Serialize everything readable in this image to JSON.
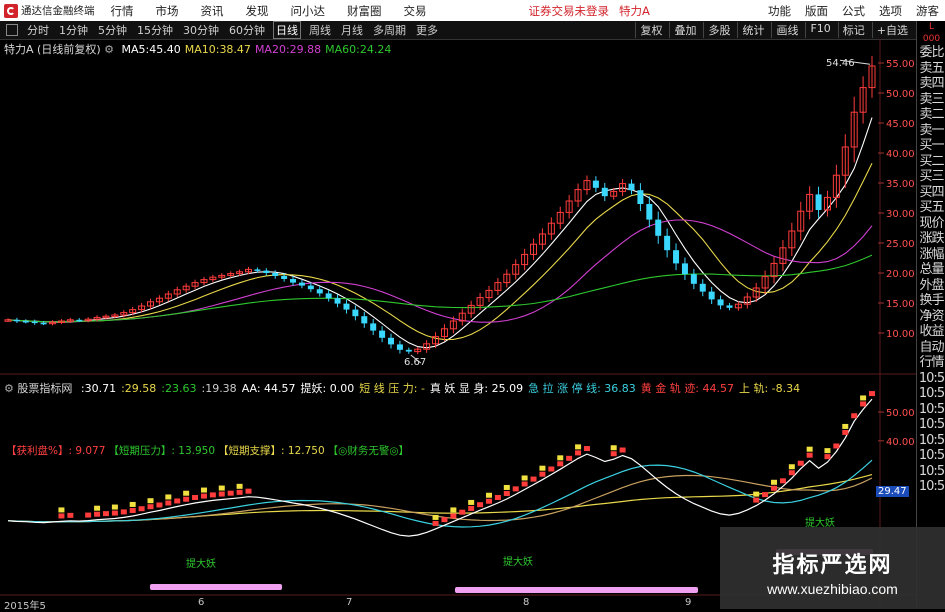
{
  "menubar": {
    "brand": "通达信金融终端",
    "items": [
      "行情",
      "市场",
      "资讯",
      "发现",
      "问小达",
      "财富圈",
      "交易"
    ],
    "status": "证券交易未登录",
    "stock_name": "特力A",
    "right_items": [
      "功能",
      "版面",
      "公式",
      "选项",
      "游客"
    ]
  },
  "periodbar": {
    "periods": [
      "分时",
      "1分钟",
      "5分钟",
      "15分钟",
      "30分钟",
      "60分钟",
      "日线",
      "周线",
      "月线",
      "多周期",
      "更多"
    ],
    "selected": "日线",
    "tools": [
      "复权",
      "叠加",
      "多股",
      "统计",
      "画线",
      "F10",
      "标记",
      "+自选"
    ]
  },
  "rpanel": {
    "header_top": "L",
    "header_sub": "000",
    "items": [
      "委比",
      "卖五",
      "卖四",
      "卖三",
      "卖二",
      "卖一",
      "买一",
      "买二",
      "买三",
      "买四",
      "买五",
      "现价",
      "涨跌",
      "涨幅",
      "总量",
      "外盘",
      "换手",
      "净资",
      "收益",
      "自动",
      "行情",
      "10:5",
      "10:5",
      "10:5",
      "10:5",
      "10:5",
      "10:5",
      "10:5",
      "10:5"
    ]
  },
  "main_legend": {
    "title": "特力A",
    "mode": "(日线前复权)",
    "ma": [
      {
        "label": "MA5:",
        "value": "45.40",
        "color": "#ffffff"
      },
      {
        "label": "MA10:",
        "value": "38.47",
        "color": "#e8d84a"
      },
      {
        "label": "MA20:",
        "value": "29.88",
        "color": "#d040d0"
      },
      {
        "label": "MA60:",
        "value": "24.24",
        "color": "#2ec72e"
      }
    ]
  },
  "sub_legend": {
    "title": "股票指标网",
    "items": [
      {
        "text": ":30.71",
        "color": "#ffffff"
      },
      {
        "text": ":29.58",
        "color": "#e8d84a"
      },
      {
        "text": ":23.63",
        "color": "#2ec72e"
      },
      {
        "text": ":19.38",
        "color": "#cccccc"
      },
      {
        "text": "AA: 44.57",
        "color": "#ffffff"
      },
      {
        "text": "提妖: 0.00",
        "color": "#ffffff"
      },
      {
        "text": "短 线 压 力: -",
        "color": "#e8d84a"
      },
      {
        "text": "真 妖 显 身: 25.09",
        "color": "#ffffff"
      },
      {
        "text": "急 拉 涨 停 线: 36.83",
        "color": "#3ad0e0"
      },
      {
        "text": "黄 金 轨 迹: 44.57",
        "color": "#ff4040"
      },
      {
        "text": "上 轨: -8.34",
        "color": "#e8d84a"
      }
    ]
  },
  "sub_legend2": [
    {
      "text": "【获利盘%】: 9.077",
      "color": "#ff4040"
    },
    {
      "text": "【短期压力】: 13.950",
      "color": "#2ec72e"
    },
    {
      "text": "【短期支撑】: 12.750",
      "color": "#e8d84a"
    },
    {
      "text": "【◎财务无警◎】",
      "color": "#2ec72e"
    }
  ],
  "annotations": {
    "high": "54.46",
    "low": "6.67",
    "sub_last": "29.47",
    "tiyao": "提大妖"
  },
  "x_labels": [
    "2015年5",
    "6",
    "7",
    "8",
    "9"
  ],
  "main_y_ticks": [
    "55.00",
    "50.00",
    "45.00",
    "40.00",
    "35.00",
    "30.00",
    "25.00",
    "20.00",
    "15.00",
    "10.00"
  ],
  "sub_y_ticks": [
    "50.00",
    "40.00"
  ],
  "watermark": {
    "line1": "指标严选网",
    "line2": "www.xuezhibiao.com"
  },
  "chart_data": {
    "type": "candlestick",
    "prices": [
      12.2,
      12.0,
      11.9,
      11.7,
      11.6,
      11.8,
      12.0,
      12.2,
      12.1,
      12.3,
      12.6,
      12.8,
      13.0,
      13.4,
      13.9,
      14.5,
      15.2,
      15.8,
      16.5,
      17.2,
      17.8,
      18.4,
      18.9,
      19.3,
      19.6,
      19.9,
      20.2,
      20.6,
      20.4,
      20.0,
      19.5,
      19.0,
      18.4,
      17.9,
      17.3,
      16.6,
      15.8,
      14.9,
      13.9,
      12.8,
      11.6,
      10.4,
      9.2,
      8.1,
      7.2,
      6.9,
      7.3,
      8.2,
      9.4,
      10.7,
      12.0,
      13.3,
      14.6,
      15.9,
      17.1,
      18.4,
      19.8,
      21.4,
      23.1,
      24.8,
      26.5,
      28.3,
      30.1,
      32.0,
      33.9,
      35.4,
      34.2,
      32.8,
      33.6,
      34.9,
      33.8,
      31.5,
      28.9,
      26.2,
      23.8,
      21.6,
      19.8,
      18.2,
      16.9,
      15.6,
      14.6,
      14.2,
      14.8,
      16.0,
      17.5,
      19.4,
      21.6,
      24.2,
      27.0,
      30.3,
      33.1,
      30.5,
      32.6,
      36.3,
      41.0,
      46.8,
      50.9,
      54.5
    ],
    "main_ylim": [
      6,
      56
    ],
    "sub_ylim": [
      -8,
      58
    ]
  }
}
